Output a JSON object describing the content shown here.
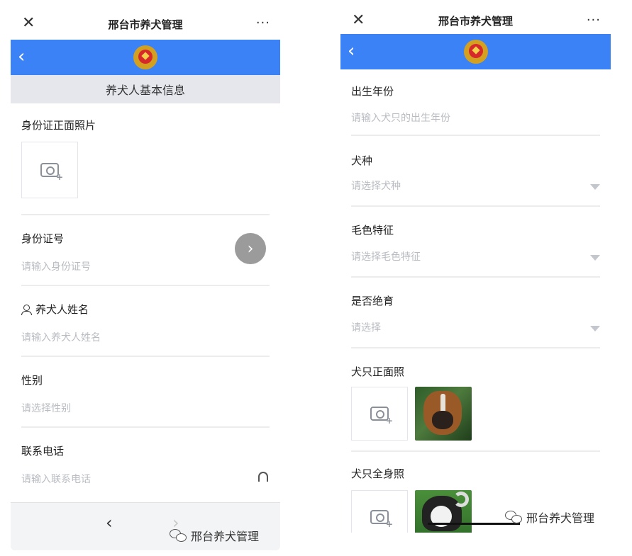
{
  "left_screen": {
    "topbar": {
      "close": "✕",
      "title": "邢台市养犬管理",
      "more": "···"
    },
    "bluebar": {
      "back": "‹"
    },
    "section_title": "养犬人基本信息",
    "id_photo": {
      "label": "身份证正面照片"
    },
    "id_number": {
      "label": "身份证号",
      "placeholder": "请输入身份证号",
      "fab": "›"
    },
    "owner_name": {
      "label": "养犬人姓名",
      "placeholder": "请输入养犬人姓名"
    },
    "gender": {
      "label": "性别",
      "placeholder": "请选择性别"
    },
    "phone": {
      "label": "联系电话",
      "placeholder": "请输入联系电话"
    },
    "bottom_nav": {
      "back": "‹",
      "forward": "›"
    },
    "watermark": "邢台养犬管理"
  },
  "right_screen": {
    "topbar": {
      "close": "✕",
      "title": "邢台市养犬管理",
      "more": "···"
    },
    "bluebar": {
      "back": "‹"
    },
    "birth_year": {
      "label": "出生年份",
      "placeholder": "请输入犬只的出生年份"
    },
    "breed": {
      "label": "犬种",
      "placeholder": "请选择犬种"
    },
    "coat_color": {
      "label": "毛色特征",
      "placeholder": "请选择毛色特征"
    },
    "sterilized": {
      "label": "是否绝育",
      "placeholder": "请选择"
    },
    "front_photo": {
      "label": "犬只正面照"
    },
    "full_photo": {
      "label": "犬只全身照"
    },
    "watermark": "邢台养犬管理"
  },
  "colors": {
    "brand_blue": "#3b82f6",
    "placeholder_gray": "#b9bcc2",
    "section_bg": "#e5e7ec"
  }
}
